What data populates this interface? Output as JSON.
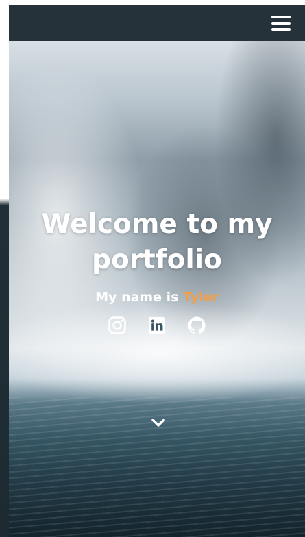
{
  "navbar": {
    "menu_icon": "hamburger-menu-icon"
  },
  "hero": {
    "title": "Welcome to my portfolio",
    "subtitle_prefix": "My name is ",
    "subtitle_name": "Tyler",
    "accent_color": "#f0a04b",
    "social_links": [
      {
        "icon": "instagram-icon"
      },
      {
        "icon": "linkedin-icon"
      },
      {
        "icon": "github-icon"
      }
    ],
    "scroll_icon": "chevron-down-icon"
  },
  "colors": {
    "navbar_bg": "#253239",
    "text": "#ffffff"
  }
}
